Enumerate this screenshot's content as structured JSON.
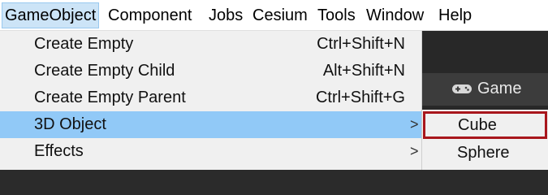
{
  "menubar": {
    "items": [
      {
        "label": "GameObject",
        "active": true
      },
      {
        "label": "Component"
      },
      {
        "label": "Jobs"
      },
      {
        "label": "Cesium"
      },
      {
        "label": "Tools"
      },
      {
        "label": "Window"
      },
      {
        "label": "Help"
      }
    ]
  },
  "dropdown": {
    "items": [
      {
        "label": "Create Empty",
        "shortcut": "Ctrl+Shift+N"
      },
      {
        "label": "Create Empty Child",
        "shortcut": "Alt+Shift+N"
      },
      {
        "label": "Create Empty Parent",
        "shortcut": "Ctrl+Shift+G"
      },
      {
        "label": "3D Object",
        "submenu_arrow": ">",
        "highlighted": true
      },
      {
        "label": "Effects",
        "submenu_arrow": ">"
      }
    ]
  },
  "submenu": {
    "items": [
      {
        "label": "Cube",
        "selected": true
      },
      {
        "label": "Sphere"
      }
    ]
  },
  "editor": {
    "game_tab_label": "Game",
    "game_tab_icon": "gamepad-icon"
  },
  "colors": {
    "highlight": "#91c9f7",
    "selection_outline": "#a8161c",
    "menubar_active": "#cce4f7"
  }
}
